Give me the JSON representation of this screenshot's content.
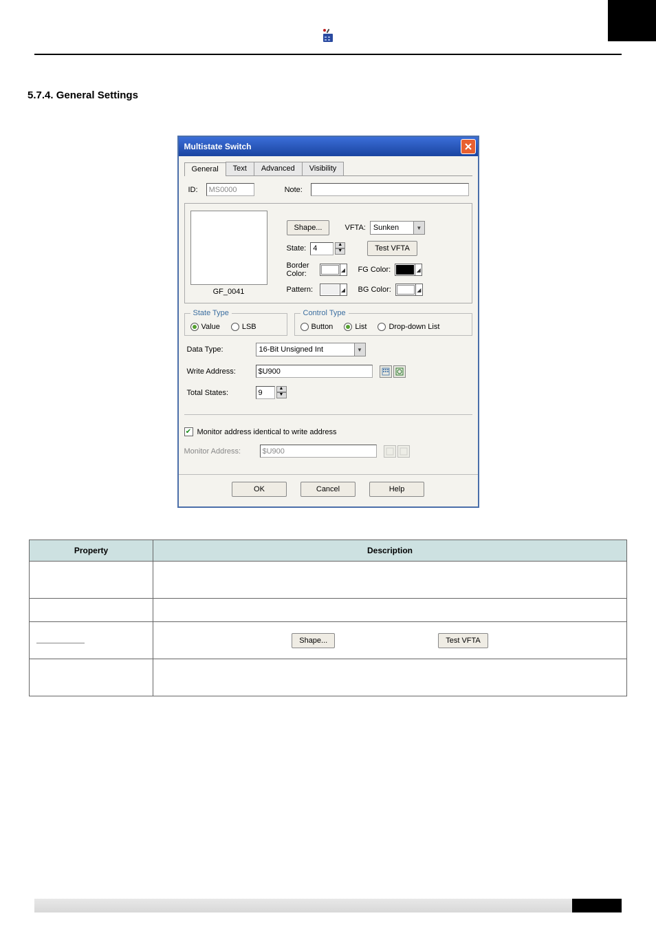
{
  "doc": {
    "section_number": "5.7.4.",
    "section_title": "General Settings"
  },
  "dialog": {
    "title": "Multistate Switch",
    "tabs": [
      "General",
      "Text",
      "Advanced",
      "Visibility"
    ],
    "active_tab": 0,
    "id_label": "ID:",
    "id_value": "MS0000",
    "note_label": "Note:",
    "note_value": "",
    "preview_caption": "GF_0041",
    "shape_btn": "Shape...",
    "vfta_label": "VFTA:",
    "vfta_value": "Sunken",
    "state_label": "State:",
    "state_value": "4",
    "testvfta_btn": "Test VFTA",
    "border_color_label": "Border Color:",
    "fg_color_label": "FG Color:",
    "pattern_label": "Pattern:",
    "bg_color_label": "BG Color:",
    "state_type_legend": "State Type",
    "state_type_options": [
      "Value",
      "LSB"
    ],
    "state_type_selected": "Value",
    "control_type_legend": "Control Type",
    "control_type_options": [
      "Button",
      "List",
      "Drop-down List"
    ],
    "control_type_selected": "List",
    "datatype_label": "Data Type:",
    "datatype_value": "16-Bit Unsigned Int",
    "writeaddr_label": "Write Address:",
    "writeaddr_value": "$U900",
    "totalstates_label": "Total States:",
    "totalstates_value": "9",
    "monitor_chk_label": "Monitor address identical to write address",
    "monitor_chk_checked": true,
    "monitoraddr_label": "Monitor Address:",
    "monitoraddr_value": "$U900",
    "ok_btn": "OK",
    "cancel_btn": "Cancel",
    "help_btn": "Help"
  },
  "table": {
    "headers": [
      "Property",
      "Description"
    ],
    "shape_btn": "Shape...",
    "testvfta_btn": "Test VFTA"
  },
  "chart_data": null
}
